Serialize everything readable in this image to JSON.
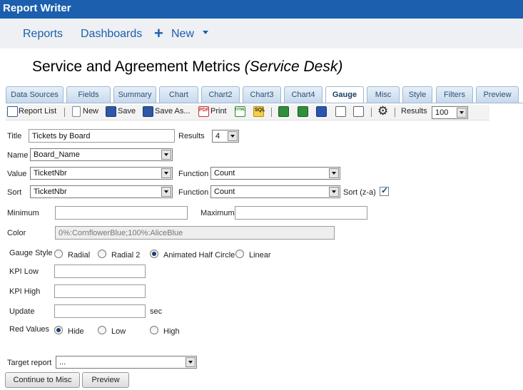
{
  "app": {
    "title": "Report Writer"
  },
  "nav": {
    "reports": "Reports",
    "dashboards": "Dashboards",
    "new": "New"
  },
  "page": {
    "title": "Service and Agreement Metrics",
    "subtitle": "(Service Desk)"
  },
  "tabs": [
    {
      "label": "Data Sources"
    },
    {
      "label": "Fields"
    },
    {
      "label": "Summary"
    },
    {
      "label": "Chart"
    },
    {
      "label": "Chart2"
    },
    {
      "label": "Chart3"
    },
    {
      "label": "Chart4"
    },
    {
      "label": "Gauge"
    },
    {
      "label": "Misc"
    },
    {
      "label": "Style"
    },
    {
      "label": "Filters"
    },
    {
      "label": "Preview"
    }
  ],
  "active_tab": "Gauge",
  "toolbar": {
    "report_list": "Report List",
    "new": "New",
    "save": "Save",
    "save_as": "Save As...",
    "print": "Print",
    "pdf_glyph": "PDF",
    "html_glyph": "HTML",
    "sql_glyph": "SQL",
    "results_label": "Results",
    "results_value": "100"
  },
  "form": {
    "title_label": "Title",
    "title_value": "Tickets by Board",
    "results_label": "Results",
    "results_value": "4",
    "name_label": "Name",
    "name_value": "Board_Name",
    "value_label": "Value",
    "value_value": "TicketNbr",
    "function_label": "Function",
    "value_function": "Count",
    "sort_label": "Sort",
    "sort_value": "TicketNbr",
    "sort_function": "Count",
    "sort_za_label": "Sort (z-a)",
    "sort_za_checked": true,
    "minimum_label": "Minimum",
    "minimum_value": "",
    "maximum_label": "Maximum",
    "maximum_value": "",
    "color_label": "Color",
    "color_value": "0%:CornflowerBlue;100%:AliceBlue",
    "gauge_style_label": "Gauge Style",
    "gauge_styles": [
      "Radial",
      "Radial 2",
      "Animated Half Circle",
      "Linear"
    ],
    "gauge_style_selected": "Animated Half Circle",
    "kpi_low_label": "KPI Low",
    "kpi_low_value": "",
    "kpi_high_label": "KPI High",
    "kpi_high_value": "",
    "update_label": "Update",
    "update_value": "",
    "update_unit": "sec",
    "red_values_label": "Red Values",
    "red_values": [
      "Hide",
      "Low",
      "High"
    ],
    "red_values_selected": "Hide",
    "target_report_label": "Target report",
    "target_report_value": "..."
  },
  "buttons": {
    "continue": "Continue to Misc",
    "preview": "Preview"
  },
  "colors": {
    "appbar": "#1b5fae",
    "nav_link": "#1b5fae",
    "tab_border": "#9db8d4"
  }
}
